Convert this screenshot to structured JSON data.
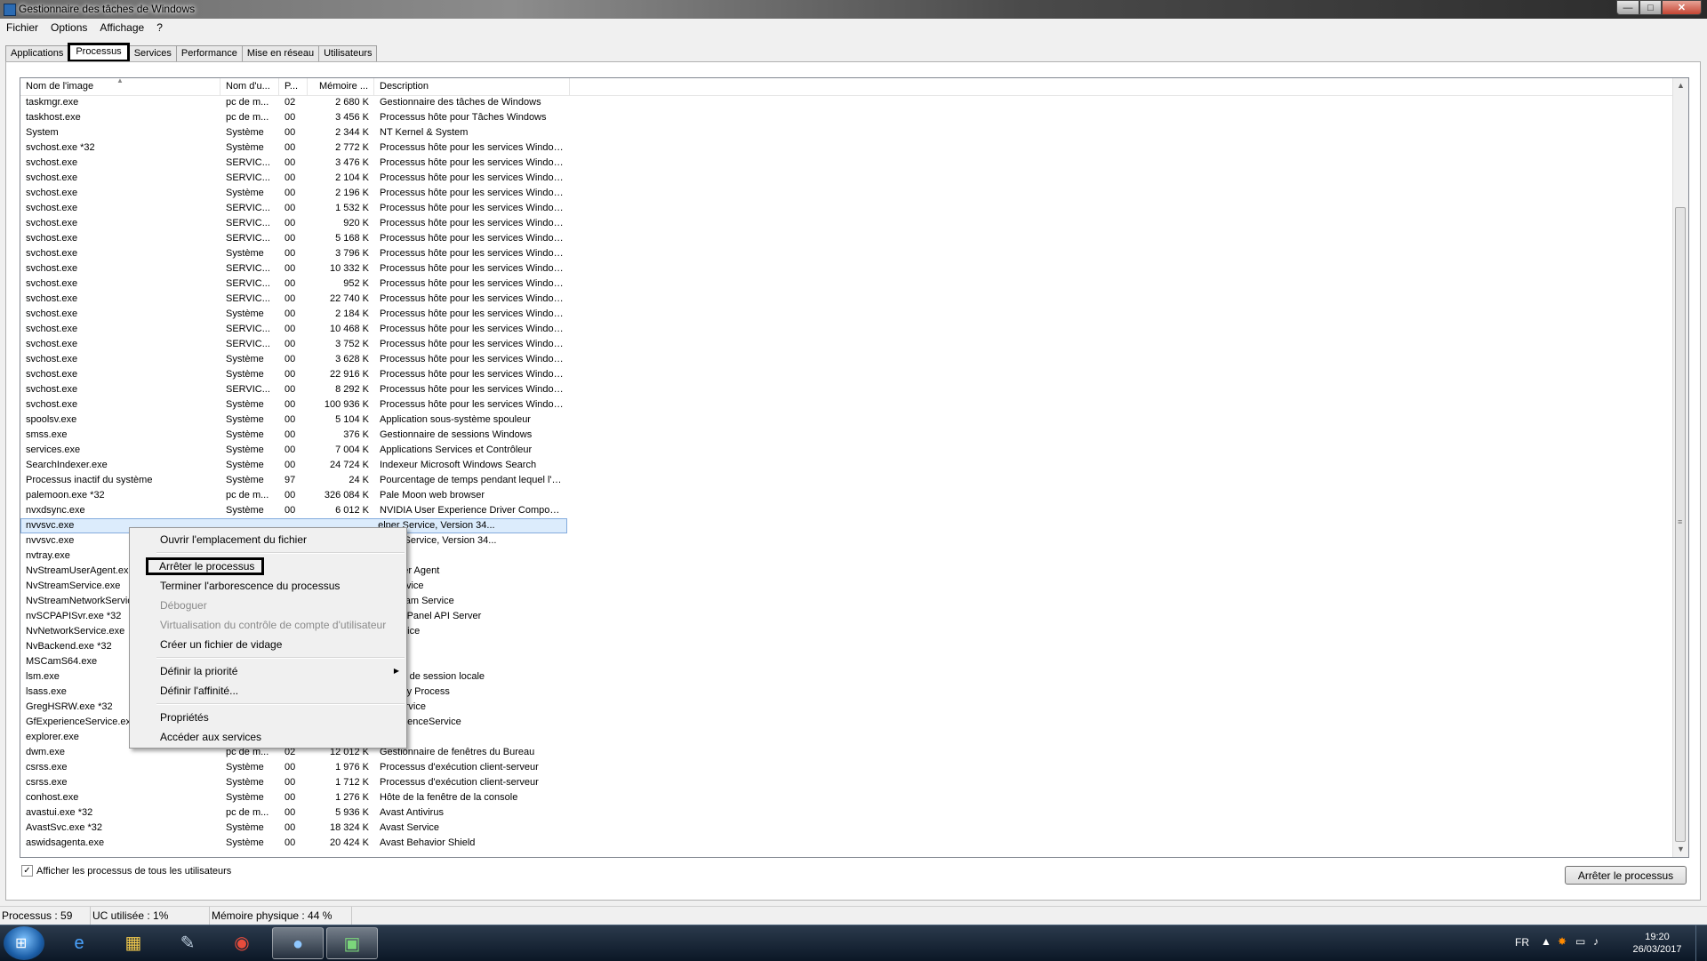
{
  "window": {
    "title": "Gestionnaire des tâches de Windows",
    "min_label": "—",
    "max_label": "□",
    "close_label": "✕"
  },
  "menu": [
    "Fichier",
    "Options",
    "Affichage",
    "?"
  ],
  "tabs": [
    "Applications",
    "Processus",
    "Services",
    "Performance",
    "Mise en réseau",
    "Utilisateurs"
  ],
  "active_tab": "Processus",
  "columns": [
    "Nom de l'image",
    "Nom d'u...",
    "P...",
    "Mémoire ...",
    "Description"
  ],
  "processes": [
    [
      "taskmgr.exe",
      "pc de m...",
      "02",
      "2 680 K",
      "Gestionnaire des tâches de Windows"
    ],
    [
      "taskhost.exe",
      "pc de m...",
      "00",
      "3 456 K",
      "Processus hôte pour Tâches Windows"
    ],
    [
      "System",
      "Système",
      "00",
      "2 344 K",
      "NT Kernel & System"
    ],
    [
      "svchost.exe *32",
      "Système",
      "00",
      "2 772 K",
      "Processus hôte pour les services Windows"
    ],
    [
      "svchost.exe",
      "SERVIC...",
      "00",
      "3 476 K",
      "Processus hôte pour les services Windows"
    ],
    [
      "svchost.exe",
      "SERVIC...",
      "00",
      "2 104 K",
      "Processus hôte pour les services Windows"
    ],
    [
      "svchost.exe",
      "Système",
      "00",
      "2 196 K",
      "Processus hôte pour les services Windows"
    ],
    [
      "svchost.exe",
      "SERVIC...",
      "00",
      "1 532 K",
      "Processus hôte pour les services Windows"
    ],
    [
      "svchost.exe",
      "SERVIC...",
      "00",
      "920 K",
      "Processus hôte pour les services Windows"
    ],
    [
      "svchost.exe",
      "SERVIC...",
      "00",
      "5 168 K",
      "Processus hôte pour les services Windows"
    ],
    [
      "svchost.exe",
      "Système",
      "00",
      "3 796 K",
      "Processus hôte pour les services Windows"
    ],
    [
      "svchost.exe",
      "SERVIC...",
      "00",
      "10 332 K",
      "Processus hôte pour les services Windows"
    ],
    [
      "svchost.exe",
      "SERVIC...",
      "00",
      "952 K",
      "Processus hôte pour les services Windows"
    ],
    [
      "svchost.exe",
      "SERVIC...",
      "00",
      "22 740 K",
      "Processus hôte pour les services Windows"
    ],
    [
      "svchost.exe",
      "Système",
      "00",
      "2 184 K",
      "Processus hôte pour les services Windows"
    ],
    [
      "svchost.exe",
      "SERVIC...",
      "00",
      "10 468 K",
      "Processus hôte pour les services Windows"
    ],
    [
      "svchost.exe",
      "SERVIC...",
      "00",
      "3 752 K",
      "Processus hôte pour les services Windows"
    ],
    [
      "svchost.exe",
      "Système",
      "00",
      "3 628 K",
      "Processus hôte pour les services Windows"
    ],
    [
      "svchost.exe",
      "Système",
      "00",
      "22 916 K",
      "Processus hôte pour les services Windows"
    ],
    [
      "svchost.exe",
      "SERVIC...",
      "00",
      "8 292 K",
      "Processus hôte pour les services Windows"
    ],
    [
      "svchost.exe",
      "Système",
      "00",
      "100 936 K",
      "Processus hôte pour les services Windows"
    ],
    [
      "spoolsv.exe",
      "Système",
      "00",
      "5 104 K",
      "Application sous-système spouleur"
    ],
    [
      "smss.exe",
      "Système",
      "00",
      "376 K",
      "Gestionnaire de sessions Windows"
    ],
    [
      "services.exe",
      "Système",
      "00",
      "7 004 K",
      "Applications Services et Contrôleur"
    ],
    [
      "SearchIndexer.exe",
      "Système",
      "00",
      "24 724 K",
      "Indexeur Microsoft Windows Search"
    ],
    [
      "Processus inactif du système",
      "Système",
      "97",
      "24 K",
      "Pourcentage de temps pendant lequel l'o..."
    ],
    [
      "palemoon.exe *32",
      "pc de m...",
      "00",
      "326 084 K",
      "Pale Moon web browser"
    ],
    [
      "nvxdsync.exe",
      "Système",
      "00",
      "6 012 K",
      "NVIDIA User Experience Driver Component"
    ],
    [
      "nvvsvc.exe",
      "",
      "",
      "",
      "elper Service, Version 34..."
    ],
    [
      "nvvsvc.exe",
      "",
      "",
      "",
      "elper Service, Version 34..."
    ],
    [
      "nvtray.exe",
      "",
      "",
      "",
      ""
    ],
    [
      "NvStreamUserAgent.ex",
      "",
      "",
      "",
      "er User Agent"
    ],
    [
      "NvStreamService.exe",
      "",
      "",
      "",
      "er Service"
    ],
    [
      "NvStreamNetworkServic",
      "",
      "",
      "",
      "k Stream Service"
    ],
    [
      "nvSCPAPISvr.exe *32",
      "",
      "",
      "",
      "ontrol Panel API Server"
    ],
    [
      "NvNetworkService.exe",
      "",
      "",
      "",
      "k Service"
    ],
    [
      "NvBackend.exe *32",
      "",
      "",
      "",
      "d"
    ],
    [
      "MSCamS64.exe",
      "",
      "",
      "",
      ""
    ],
    [
      "lsm.exe",
      "",
      "",
      "",
      "nnaire de session locale"
    ],
    [
      "lsass.exe",
      "",
      "",
      "",
      "uthority Process"
    ],
    [
      "GregHSRW.exe *32",
      "",
      "",
      "",
      "on Service"
    ],
    [
      "GfExperienceService.ex",
      "",
      "",
      "",
      "ExperienceService"
    ],
    [
      "explorer.exe",
      "",
      "",
      "",
      "dows"
    ],
    [
      "dwm.exe",
      "pc de m...",
      "02",
      "12 012 K",
      "Gestionnaire de fenêtres du Bureau"
    ],
    [
      "csrss.exe",
      "Système",
      "00",
      "1 976 K",
      "Processus d'exécution client-serveur"
    ],
    [
      "csrss.exe",
      "Système",
      "00",
      "1 712 K",
      "Processus d'exécution client-serveur"
    ],
    [
      "conhost.exe",
      "Système",
      "00",
      "1 276 K",
      "Hôte de la fenêtre de la console"
    ],
    [
      "avastui.exe *32",
      "pc de m...",
      "00",
      "5 936 K",
      "Avast Antivirus"
    ],
    [
      "AvastSvc.exe *32",
      "Système",
      "00",
      "18 324 K",
      "Avast Service"
    ],
    [
      "aswidsagenta.exe",
      "Système",
      "00",
      "20 424 K",
      "Avast Behavior Shield"
    ]
  ],
  "selected_row": 28,
  "context_menu": [
    {
      "label": "Ouvrir l'emplacement du fichier",
      "enabled": true
    },
    {
      "sep": true
    },
    {
      "label": "Arrêter le processus",
      "enabled": true,
      "boxed": true
    },
    {
      "label": "Terminer l'arborescence du processus",
      "enabled": true
    },
    {
      "label": "Déboguer",
      "enabled": false
    },
    {
      "label": "Virtualisation du contrôle de compte d'utilisateur",
      "enabled": false
    },
    {
      "label": "Créer un fichier de vidage",
      "enabled": true
    },
    {
      "sep": true
    },
    {
      "label": "Définir la priorité",
      "enabled": true,
      "submenu": true
    },
    {
      "label": "Définir l'affinité...",
      "enabled": true
    },
    {
      "sep": true
    },
    {
      "label": "Propriétés",
      "enabled": true
    },
    {
      "label": "Accéder aux services",
      "enabled": true
    }
  ],
  "show_all_users": {
    "label": "Afficher les processus de tous les utilisateurs",
    "checked": true
  },
  "end_button": "Arrêter le processus",
  "status": {
    "processes": "Processus : 59",
    "cpu": "UC utilisée : 1%",
    "memory": "Mémoire physique : 44 %"
  },
  "taskbar": {
    "lang": "FR",
    "time": "19:20",
    "date": "26/03/2017",
    "icons": [
      "internet-explorer-icon",
      "file-explorer-icon",
      "pinned-app-icon",
      "chrome-icon",
      "pale-moon-icon",
      "task-manager-icon"
    ]
  },
  "colors": {
    "selection": "#cde8ff",
    "taskbar": "#0b1726",
    "title_accent": "#2b6bb3"
  }
}
